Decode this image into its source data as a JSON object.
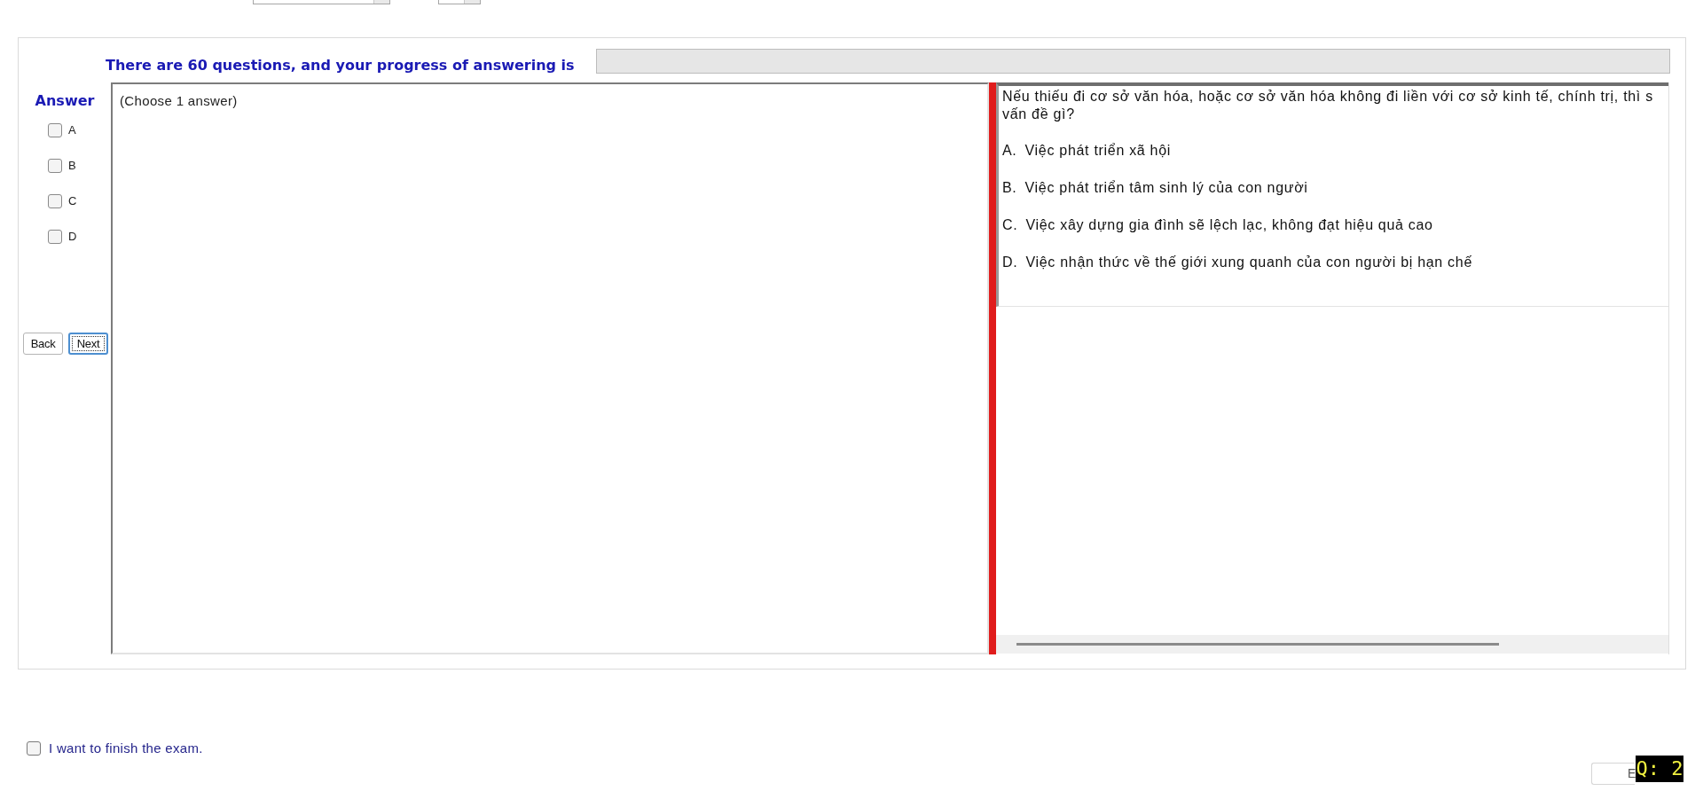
{
  "progress_header": {
    "text": "There are 60 questions, and your progress of answering is",
    "level": 0
  },
  "answer_panel": {
    "title": "Answer",
    "choices": [
      {
        "label": "A",
        "checked": false
      },
      {
        "label": "B",
        "checked": false
      },
      {
        "label": "C",
        "checked": false
      },
      {
        "label": "D",
        "checked": false
      }
    ]
  },
  "nav_buttons": [
    {
      "label": "Back",
      "focused": false
    },
    {
      "label": "Next",
      "focused": true
    }
  ],
  "instruction": "(Choose 1 answer)",
  "question": {
    "lines": [
      "Nếu thiếu đi cơ sở văn hóa, hoặc cơ sở văn hóa không đi liền với cơ sở kinh tế, chính trị, thì s",
      "vấn đề gì?"
    ],
    "options": [
      {
        "label": "A.",
        "text": "Việc phát triển xã hội"
      },
      {
        "label": "B.",
        "text": "Việc phát triển tâm sinh lý của con người"
      },
      {
        "label": "C.",
        "text": "Việc xây dựng gia đình sẽ lệch lạc, không đạt hiệu quả cao"
      },
      {
        "label": "D.",
        "text": "Việc nhận thức về thế giới xung quanh của con người bị hạn chế"
      }
    ]
  },
  "finish": {
    "label": "I want to finish the exam.",
    "checked": false
  },
  "bottom_button": {
    "label": "E"
  },
  "question_badge": "Q: 2"
}
